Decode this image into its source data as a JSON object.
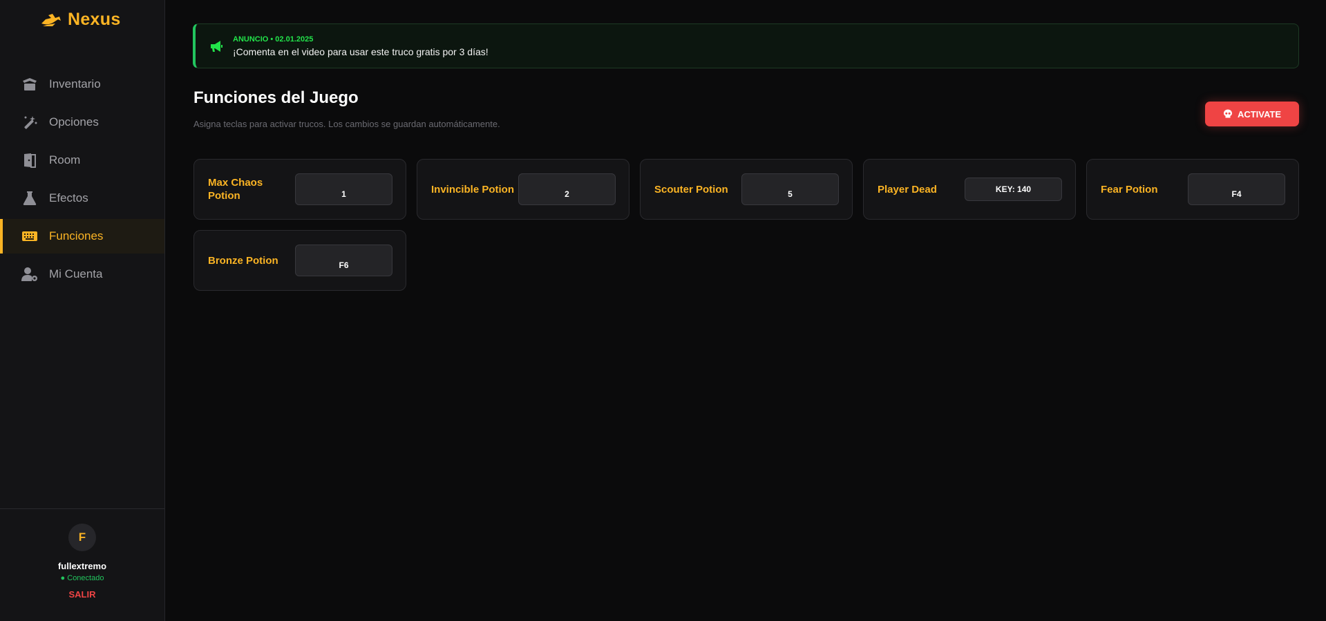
{
  "brand": {
    "name": "Nexus",
    "accent": "#fbb424"
  },
  "sidebar": {
    "items": [
      {
        "label": "Inventario",
        "icon": "box-open-icon",
        "active": false
      },
      {
        "label": "Opciones",
        "icon": "magic-wand-icon",
        "active": false
      },
      {
        "label": "Room",
        "icon": "door-open-icon",
        "active": false
      },
      {
        "label": "Efectos",
        "icon": "flask-icon",
        "active": false
      },
      {
        "label": "Funciones",
        "icon": "keyboard-icon",
        "active": true
      },
      {
        "label": "Mi Cuenta",
        "icon": "user-gear-icon",
        "active": false
      }
    ]
  },
  "user": {
    "initial": "F",
    "name": "fullextremo",
    "status": "● Conectado",
    "logout": "SALIR"
  },
  "announcement": {
    "meta": "ANUNCIO • 02.01.2025",
    "text": "¡Comenta en el video para usar este truco gratis por 3 días!",
    "icon": "megaphone-icon",
    "color": "#22c55e"
  },
  "main": {
    "title": "Funciones del Juego",
    "subtitle": "Asigna teclas para activar trucos. Los cambios se guardan automáticamente.",
    "activate_label": "ACTIVATE",
    "activate_icon": "skull-icon",
    "activate_color": "#ef4444"
  },
  "functions": [
    {
      "name": "Max Chaos Potion",
      "key": "1"
    },
    {
      "name": "Invincible Potion",
      "key": "2"
    },
    {
      "name": "Scouter Potion",
      "key": "5"
    },
    {
      "name": "Player Dead",
      "key": "KEY: 140"
    },
    {
      "name": "Fear Potion",
      "key": "F4"
    },
    {
      "name": "Bronze Potion",
      "key": "F6"
    }
  ]
}
